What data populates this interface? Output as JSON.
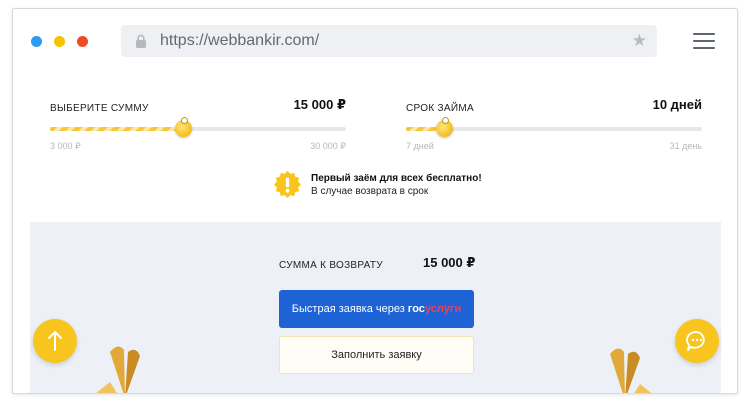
{
  "browser": {
    "url": "https://webbankir.com/",
    "window_dots": [
      "#2e9bf0",
      "#f5c400",
      "#ee4b2b"
    ]
  },
  "sliders": {
    "amount": {
      "label": "ВЫБЕРИТЕ СУММУ",
      "value": "15 000 ₽",
      "min_label": "3 000 ₽",
      "max_label": "30 000 ₽",
      "fraction": 0.45
    },
    "term": {
      "label": "СРОК ЗАЙМА",
      "value": "10 дней",
      "min_label": "7 дней",
      "max_label": "31 день",
      "fraction": 0.13
    }
  },
  "promo": {
    "title": "Первый заём для всех бесплатно!",
    "subtitle": "В случае возврата в срок",
    "icon": "exclamation-badge-icon"
  },
  "repayment": {
    "label": "СУММА К ВОЗВРАТУ",
    "value": "15 000 ₽"
  },
  "buttons": {
    "gosuslugi_prefix": "Быстрая заявка через",
    "gosuslugi_gos": "гос",
    "gosuslugi_uslugi": "услуги",
    "fill_form": "Заполнить заявку"
  },
  "colors": {
    "accent_yellow": "#f7c51e",
    "primary_blue": "#1e63d6",
    "panel_bg": "#edf0f7"
  }
}
